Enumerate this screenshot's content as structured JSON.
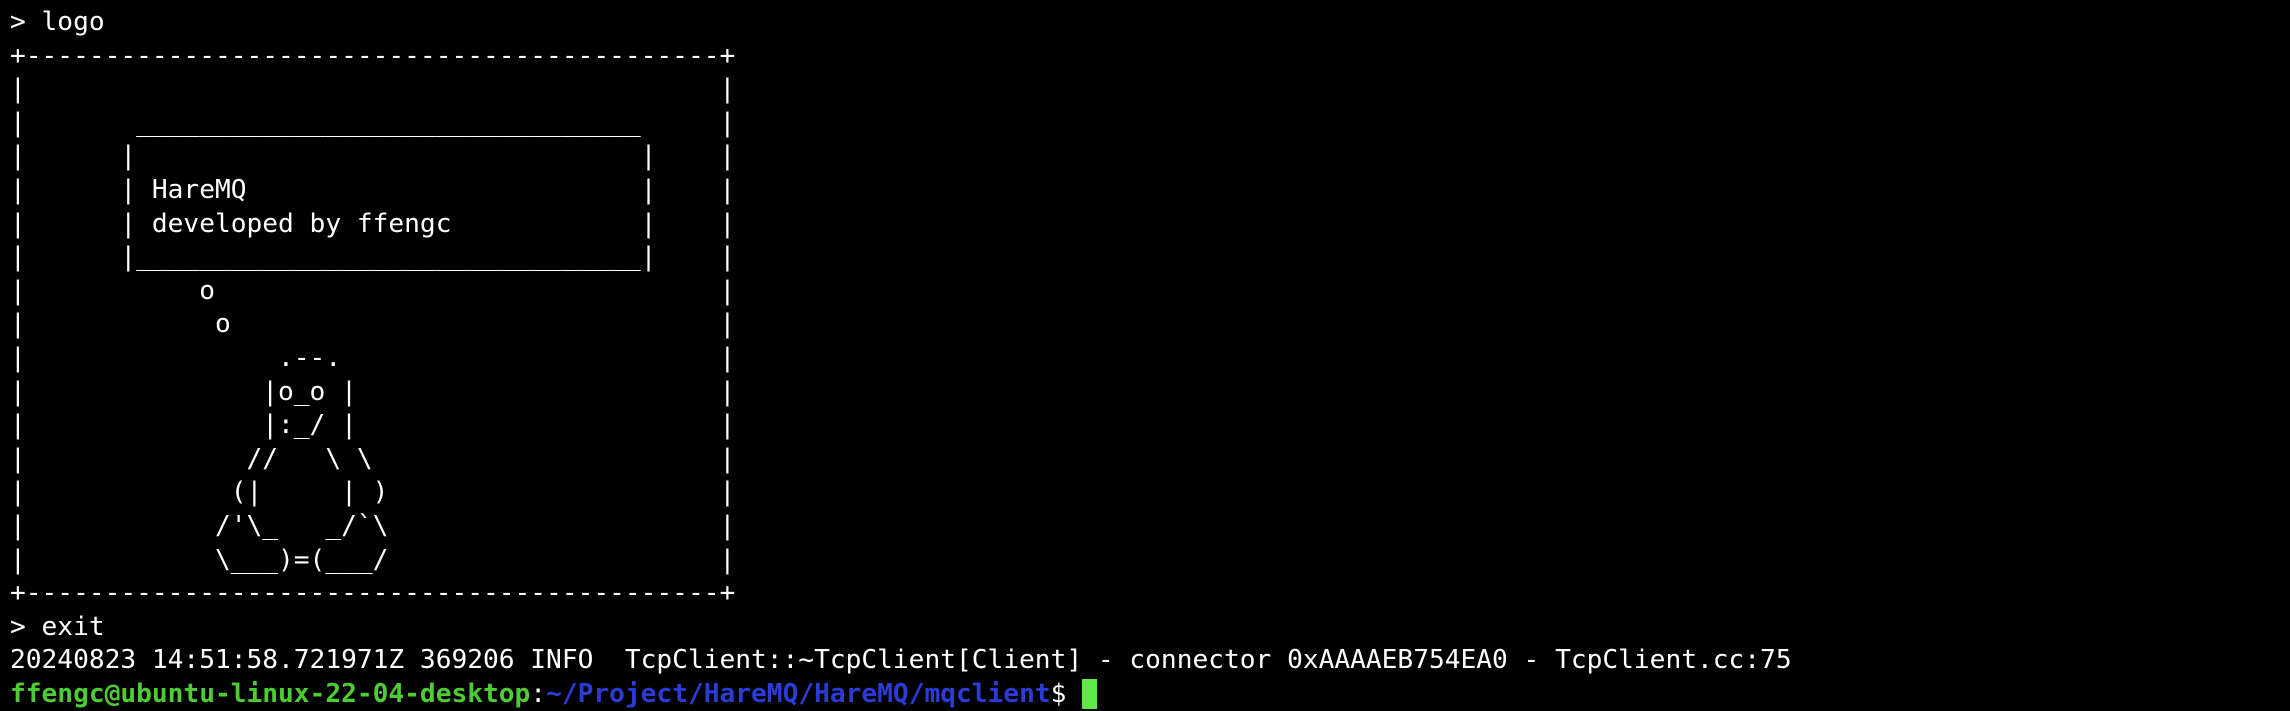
{
  "colors": {
    "background": "#000000",
    "foreground": "#ffffff",
    "prompt_user": "#4dcc33",
    "prompt_path": "#2a3bd6",
    "cursor": "#5dea47"
  },
  "terminal": {
    "lines": [
      "> logo",
      "+--------------------------------------------+",
      "|                                            |",
      "|       ________________________________     |",
      "|      |                                |    |",
      "|      | HareMQ                         |    |",
      "|      | developed by ffengc            |    |",
      "|      |________________________________|    |",
      "|           o                                |",
      "|            o                               |",
      "|                .--.                        |",
      "|               |o_o |                       |",
      "|               |:_/ |                       |",
      "|              //   \\ \\                      |",
      "|             (|     | )                     |",
      "|            /'\\_   _/`\\                     |",
      "|            \\___)=(___/                     |",
      "+--------------------------------------------+",
      "> exit",
      "20240823 14:51:58.721971Z 369206 INFO  TcpClient::~TcpClient[Client] - connector 0xAAAAEB754EA0 - TcpClient.cc:75"
    ],
    "prompt": {
      "user_host": "ffengc@ubuntu-linux-22-04-desktop",
      "separator": ":",
      "path": "~/Project/HareMQ/HareMQ/mqclient",
      "symbol": "$"
    },
    "cursor_shape": "block"
  }
}
